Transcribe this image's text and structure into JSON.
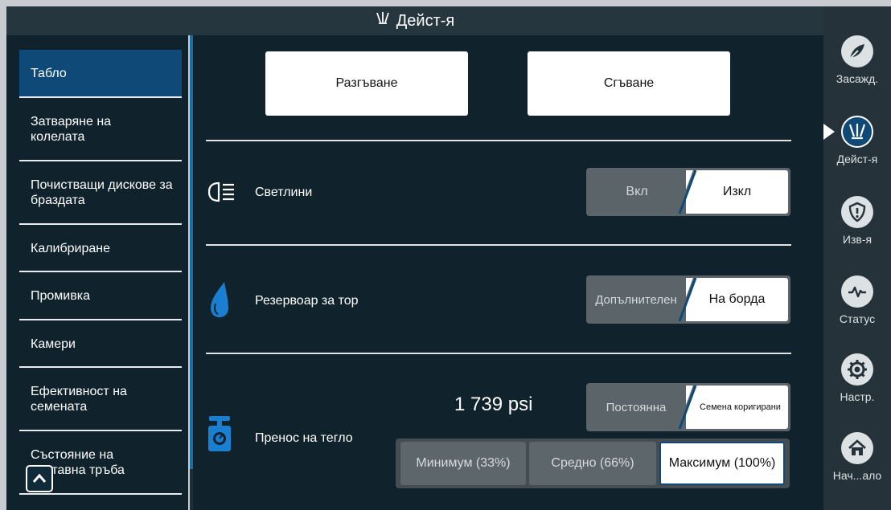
{
  "title": "Дейст-я",
  "nav": {
    "items": [
      {
        "label": "Табло",
        "active": true
      },
      {
        "label": "Затваряне на колелата",
        "active": false
      },
      {
        "label": "Почистващи дискове за браздата",
        "active": false
      },
      {
        "label": "Калибриране",
        "active": false
      },
      {
        "label": "Промивка",
        "active": false
      },
      {
        "label": "Камери",
        "active": false
      },
      {
        "label": "Ефективност на семената",
        "active": false
      },
      {
        "label": "Състояние на доставна тръба",
        "active": false
      }
    ]
  },
  "actions": {
    "unfold_label": "Разгъване",
    "fold_label": "Сгъване"
  },
  "lights": {
    "label": "Светлини",
    "icon": "headlight-icon",
    "options": [
      "Вкл",
      "Изкл"
    ],
    "selected": "Изкл"
  },
  "fertilizer": {
    "label": "Резервоар за тор",
    "icon": "water-drop-icon",
    "options": [
      "Допълнителен",
      "На борда"
    ],
    "selected": "На борда"
  },
  "weight_transfer": {
    "label": "Пренос на тегло",
    "icon": "scale-icon",
    "pressure": "1 739 psi",
    "mode_options": [
      "Постоянна",
      "Семена коригирани"
    ],
    "mode_selected": "Семена коригирани",
    "levels": [
      "Минимум (33%)",
      "Средно (66%)",
      "Максимум (100%)"
    ],
    "level_selected": "Максимум (100%)"
  },
  "rail": {
    "items": [
      {
        "label": "Засажд.",
        "icon": "planting-icon",
        "active": false
      },
      {
        "label": "Дейст-я",
        "icon": "actions-icon",
        "active": true
      },
      {
        "label": "Изв-я",
        "icon": "alerts-shield-icon",
        "active": false
      },
      {
        "label": "Статус",
        "icon": "status-pulse-icon",
        "active": false
      },
      {
        "label": "Настр.",
        "icon": "settings-gear-icon",
        "active": false
      },
      {
        "label": "Нач...ало",
        "icon": "home-icon",
        "active": false
      }
    ]
  },
  "colors": {
    "background": "#10232c",
    "titlebar": "#26363e",
    "accent": "#0e4978",
    "rail": "#253239",
    "drop_icon": "#1b7fd1"
  }
}
